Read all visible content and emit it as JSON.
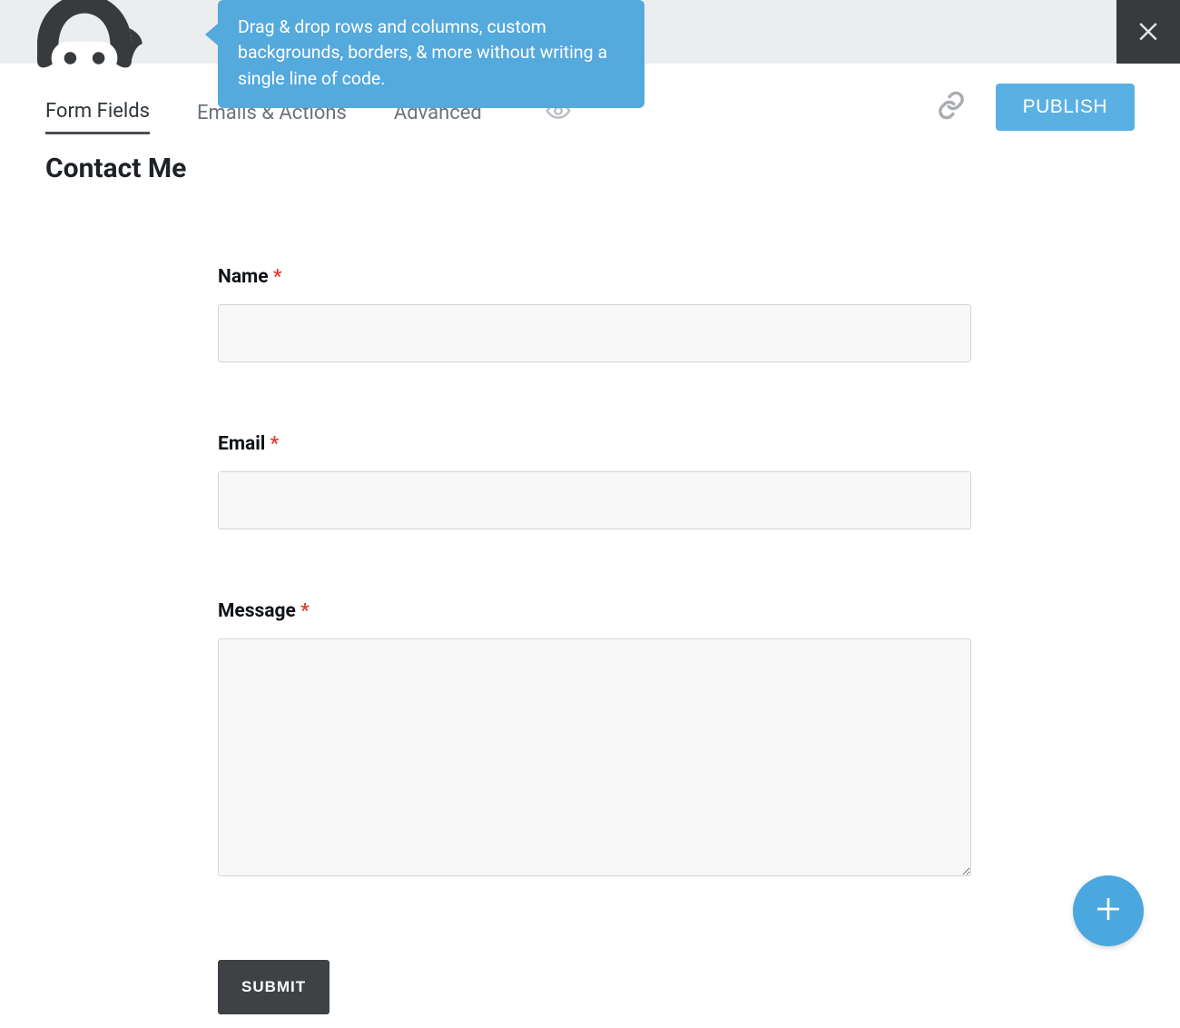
{
  "tooltip": {
    "text": "Drag & drop rows and columns, custom backgrounds, borders, & more without writing a single line of code."
  },
  "tabs": {
    "formFields": "Form Fields",
    "emailsActions": "Emails & Actions",
    "advanced": "Advanced"
  },
  "actions": {
    "publish": "PUBLISH"
  },
  "form": {
    "title": "Contact Me",
    "fields": {
      "name": {
        "label": "Name",
        "required": "*"
      },
      "email": {
        "label": "Email",
        "required": "*"
      },
      "message": {
        "label": "Message",
        "required": "*"
      }
    },
    "submit": "SUBMIT"
  }
}
